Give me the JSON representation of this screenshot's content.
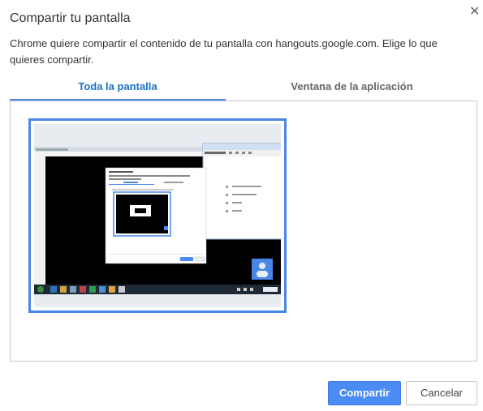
{
  "dialog": {
    "title": "Compartir tu pantalla",
    "description": "Chrome quiere compartir el contenido de tu pantalla con hangouts.google.com. Elige lo que quieres compartir.",
    "close_glyph": "✕"
  },
  "tabs": [
    {
      "label": "Toda la pantalla",
      "active": true
    },
    {
      "label": "Ventana de la aplicación",
      "active": false
    }
  ],
  "sources": [
    {
      "name": "entire-screen-thumbnail",
      "selected": true
    }
  ],
  "buttons": {
    "share": "Compartir",
    "cancel": "Cancelar"
  },
  "colors": {
    "accent": "#4a86e8",
    "primary_button": "#4b8bf4",
    "active_tab_text": "#1a73c8",
    "inactive_tab_text": "#666666"
  },
  "icons": {
    "close": "close-icon",
    "avatar": "avatar-icon"
  }
}
